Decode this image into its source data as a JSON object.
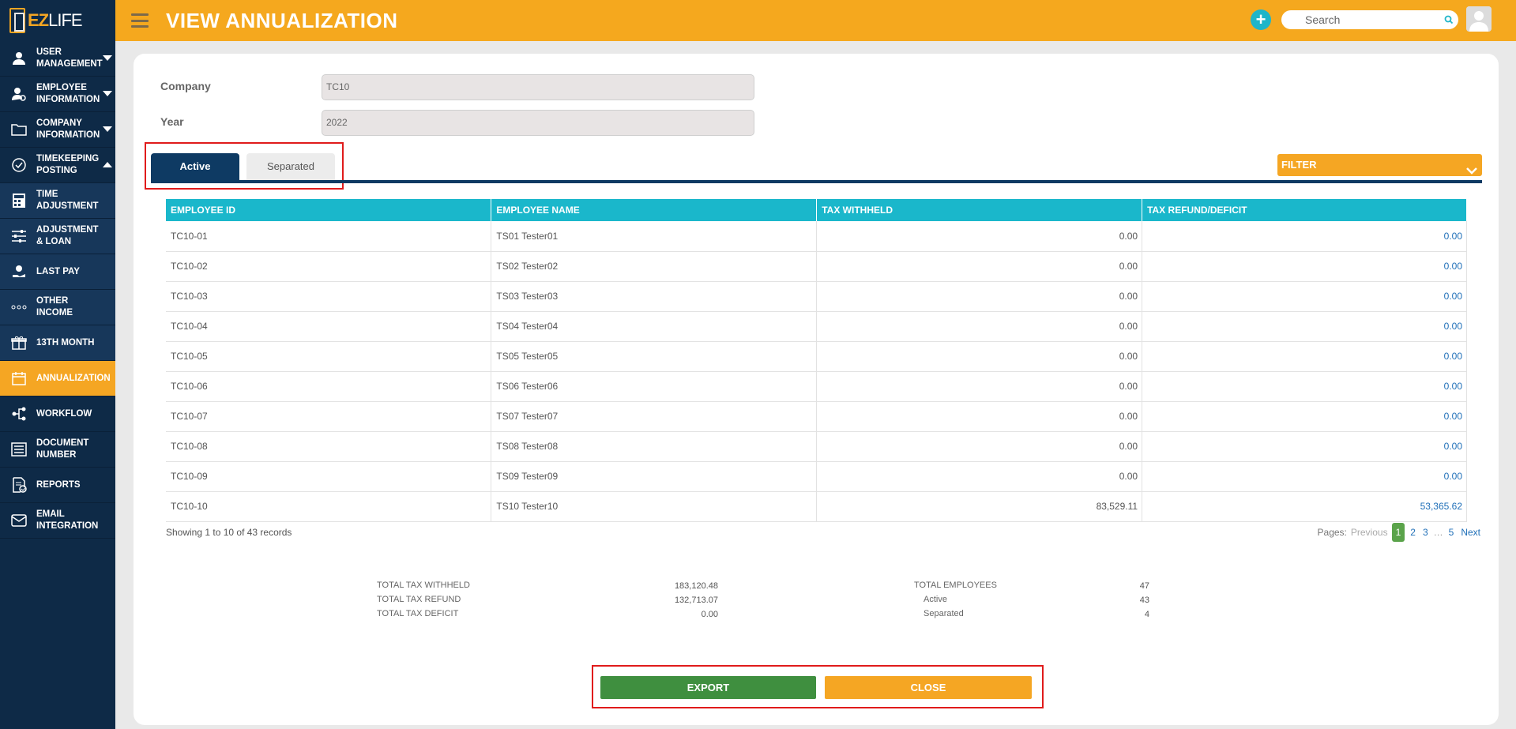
{
  "app": {
    "logo_ez": "EZ",
    "logo_life": "LIFE"
  },
  "sidebar": {
    "items": [
      {
        "label": "USER MANAGEMENT",
        "icon": "user-icon"
      },
      {
        "label": "EMPLOYEE INFORMATION",
        "icon": "employee-icon"
      },
      {
        "label": "COMPANY INFORMATION",
        "icon": "folder-icon"
      },
      {
        "label": "TIMEKEEPING POSTING",
        "icon": "check-circle-icon"
      },
      {
        "label": "TIME ADJUSTMENT",
        "icon": "calculator-icon"
      },
      {
        "label": "ADJUSTMENT & LOAN",
        "icon": "sliders-icon"
      },
      {
        "label": "LAST PAY",
        "icon": "hand-coin-icon"
      },
      {
        "label": "OTHER INCOME",
        "icon": "dots-icon"
      },
      {
        "label": "13TH MONTH",
        "icon": "gift-icon"
      },
      {
        "label": "ANNUALIZATION",
        "icon": "calendar-icon"
      },
      {
        "label": "WORKFLOW",
        "icon": "flow-icon"
      },
      {
        "label": "DOCUMENT NUMBER",
        "icon": "document-list-icon"
      },
      {
        "label": "REPORTS",
        "icon": "report-icon"
      },
      {
        "label": "EMAIL INTEGRATION",
        "icon": "mail-icon"
      }
    ]
  },
  "header": {
    "title": "VIEW ANNUALIZATION",
    "search_placeholder": "Search"
  },
  "form": {
    "company_label": "Company",
    "company_value": "TC10",
    "year_label": "Year",
    "year_value": "2022"
  },
  "tabs": {
    "active": "Active",
    "separated": "Separated"
  },
  "filter_label": "FILTER",
  "table": {
    "headers": [
      "EMPLOYEE ID",
      "EMPLOYEE NAME",
      "TAX WITHHELD",
      "TAX REFUND/DEFICIT"
    ],
    "rows": [
      [
        "TC10-01",
        "TS01 Tester01",
        "0.00",
        "0.00"
      ],
      [
        "TC10-02",
        "TS02 Tester02",
        "0.00",
        "0.00"
      ],
      [
        "TC10-03",
        "TS03 Tester03",
        "0.00",
        "0.00"
      ],
      [
        "TC10-04",
        "TS04 Tester04",
        "0.00",
        "0.00"
      ],
      [
        "TC10-05",
        "TS05 Tester05",
        "0.00",
        "0.00"
      ],
      [
        "TC10-06",
        "TS06 Tester06",
        "0.00",
        "0.00"
      ],
      [
        "TC10-07",
        "TS07 Tester07",
        "0.00",
        "0.00"
      ],
      [
        "TC10-08",
        "TS08 Tester08",
        "0.00",
        "0.00"
      ],
      [
        "TC10-09",
        "TS09 Tester09",
        "0.00",
        "0.00"
      ],
      [
        "TC10-10",
        "TS10 Tester10",
        "83,529.11",
        "53,365.62"
      ]
    ]
  },
  "records_text": "Showing 1 to 10 of 43 records",
  "pager": {
    "label": "Pages:",
    "previous": "Previous",
    "pages": [
      "1",
      "2",
      "3"
    ],
    "dots": "…",
    "last": "5",
    "next": "Next"
  },
  "summary": {
    "total_tax_withheld_label": "TOTAL TAX WITHHELD",
    "total_tax_withheld": "183,120.48",
    "total_tax_refund_label": "TOTAL TAX REFUND",
    "total_tax_refund": "132,713.07",
    "total_tax_deficit_label": "TOTAL TAX DEFICIT",
    "total_tax_deficit": "0.00",
    "total_employees_label": "TOTAL EMPLOYEES",
    "total_employees": "47",
    "active_label": "Active",
    "active": "43",
    "separated_label": "Separated",
    "separated": "4"
  },
  "actions": {
    "export": "EXPORT",
    "close": "CLOSE"
  },
  "colors": {
    "header": "#f5a81e",
    "sidebar": "#0e2a47",
    "table_header": "#1ab7cb",
    "export": "#3f8f3f",
    "close": "#f5a623",
    "highlight": "#e01b1b"
  }
}
